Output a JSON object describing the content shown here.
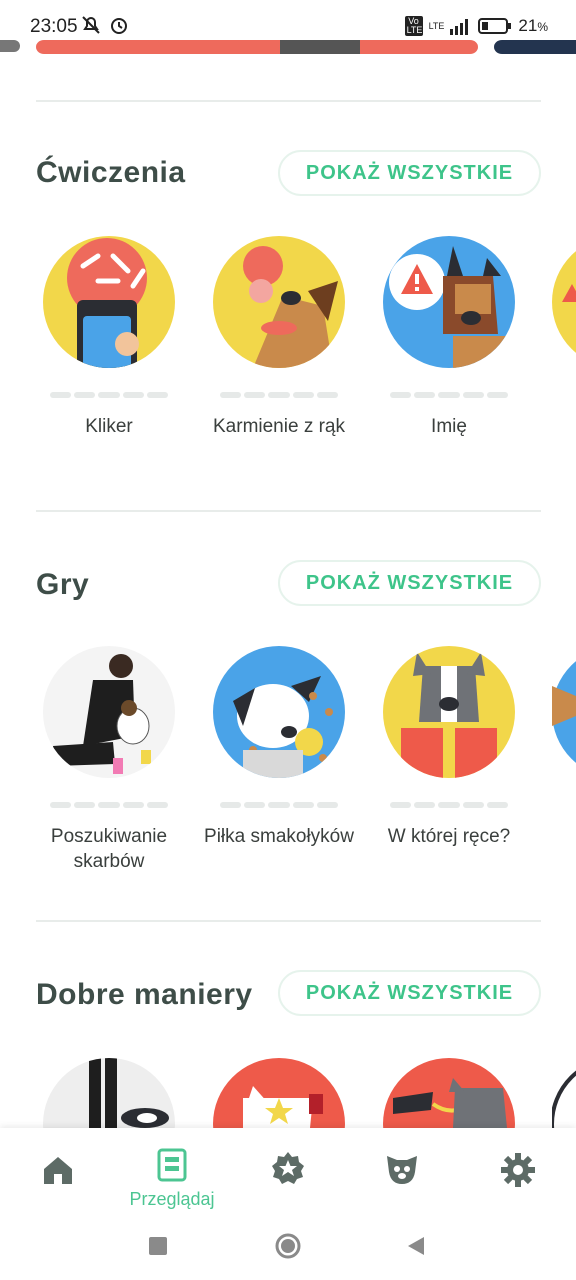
{
  "status_bar": {
    "time": "23:05",
    "network": "LTE",
    "volte": "Vo LTE",
    "battery": "21",
    "battery_unit": "%"
  },
  "sections": [
    {
      "title": "Ćwiczenia",
      "show_all_label": "POKAŻ WSZYSTKIE",
      "items": [
        {
          "label": "Kliker",
          "image": "clicker-illustration"
        },
        {
          "label": "Karmienie z rąk",
          "image": "hand-feeding-illustration"
        },
        {
          "label": "Imię",
          "image": "name-warning-illustration"
        }
      ]
    },
    {
      "title": "Gry",
      "show_all_label": "POKAŻ WSZYSTKIE",
      "items": [
        {
          "label": "Poszukiwanie skarbów",
          "image": "treasure-hunt-photo"
        },
        {
          "label": "Piłka smakołyków",
          "image": "treat-ball-illustration"
        },
        {
          "label": "W której ręce?",
          "image": "which-hand-illustration"
        }
      ]
    },
    {
      "title": "Dobre maniery",
      "show_all_label": "POKAŻ WSZYSTKIE",
      "items": [
        {
          "label": "",
          "image": "walking-photo"
        },
        {
          "label": "",
          "image": "cat-dog-illustration"
        },
        {
          "label": "",
          "image": "leash-illustration"
        }
      ]
    }
  ],
  "bottom_nav": [
    {
      "name": "home",
      "label": "",
      "icon": "home-icon"
    },
    {
      "name": "browse",
      "label": "Przeglądaj",
      "icon": "browse-icon",
      "active": true
    },
    {
      "name": "achievements",
      "label": "",
      "icon": "badge-icon"
    },
    {
      "name": "dog-profile",
      "label": "",
      "icon": "dog-face-icon"
    },
    {
      "name": "settings",
      "label": "",
      "icon": "gear-icon"
    }
  ],
  "colors": {
    "accent": "#3ec48a",
    "title": "#3e4d48",
    "nav_inactive": "#5d6b66"
  }
}
